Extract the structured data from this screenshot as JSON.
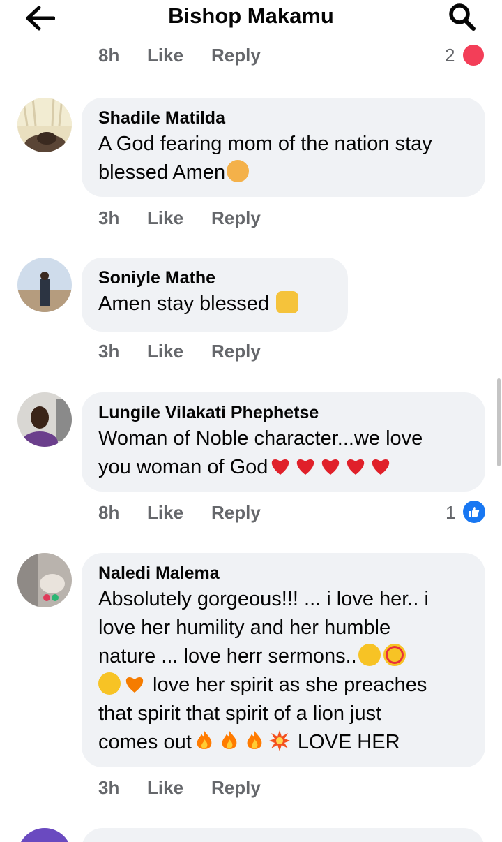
{
  "header": {
    "title": "Bishop Makamu",
    "back_icon": "arrow-left-icon",
    "search_icon": "search-icon"
  },
  "previous_comment": {
    "timestamp": "8h",
    "like_label": "Like",
    "reply_label": "Reply",
    "reaction_count": "2"
  },
  "comments": [
    {
      "author": "Shadile Matilda",
      "text": "A God fearing mom of the nation stay blessed Amen",
      "emoji": [
        "raising-hand-emoji"
      ],
      "timestamp": "3h",
      "like_label": "Like",
      "reply_label": "Reply"
    },
    {
      "author": "Soniyle Mathe",
      "text": "Amen  stay blessed",
      "emoji": [
        "raised-hands-emoji"
      ],
      "timestamp": "3h",
      "like_label": "Like",
      "reply_label": "Reply"
    },
    {
      "author": "Lungile Vilakati Phephetse",
      "text_line1": "Woman of Noble character...we love",
      "text_line2": "you woman of God",
      "emoji": [
        "red-heart-emoji",
        "red-heart-emoji",
        "red-heart-emoji",
        "red-heart-emoji",
        "red-heart-emoji"
      ],
      "timestamp": "8h",
      "like_label": "Like",
      "reply_label": "Reply",
      "reaction_count": "1"
    },
    {
      "author": "Naledi Malema",
      "text_line1": "Absolutely gorgeous!!! ... i love her.. i",
      "text_line2": "love her humility and her humble",
      "text_line3": "nature  ... love herr sermons..",
      "text_line4": " love her spirit as she preaches",
      "text_line5": "that spirit that spirit of a lion just",
      "text_line6": "comes out",
      "text_line6_tail": " LOVE  HER",
      "emoji": [
        "star-struck-emoji",
        "heart-eyes-emoji",
        "face-blowing-kiss-emoji",
        "orange-heart-emoji",
        "fire-emoji",
        "fire-emoji",
        "fire-emoji",
        "collision-emoji"
      ],
      "timestamp": "3h",
      "like_label": "Like",
      "reply_label": "Reply"
    }
  ],
  "colors": {
    "bubble": "#f0f2f5",
    "meta_text": "#65676b",
    "like_badge": "#1877f2",
    "heart_reaction": "#f33e58",
    "heart_emoji": "#e0202a",
    "fire": "#ff7b00"
  }
}
